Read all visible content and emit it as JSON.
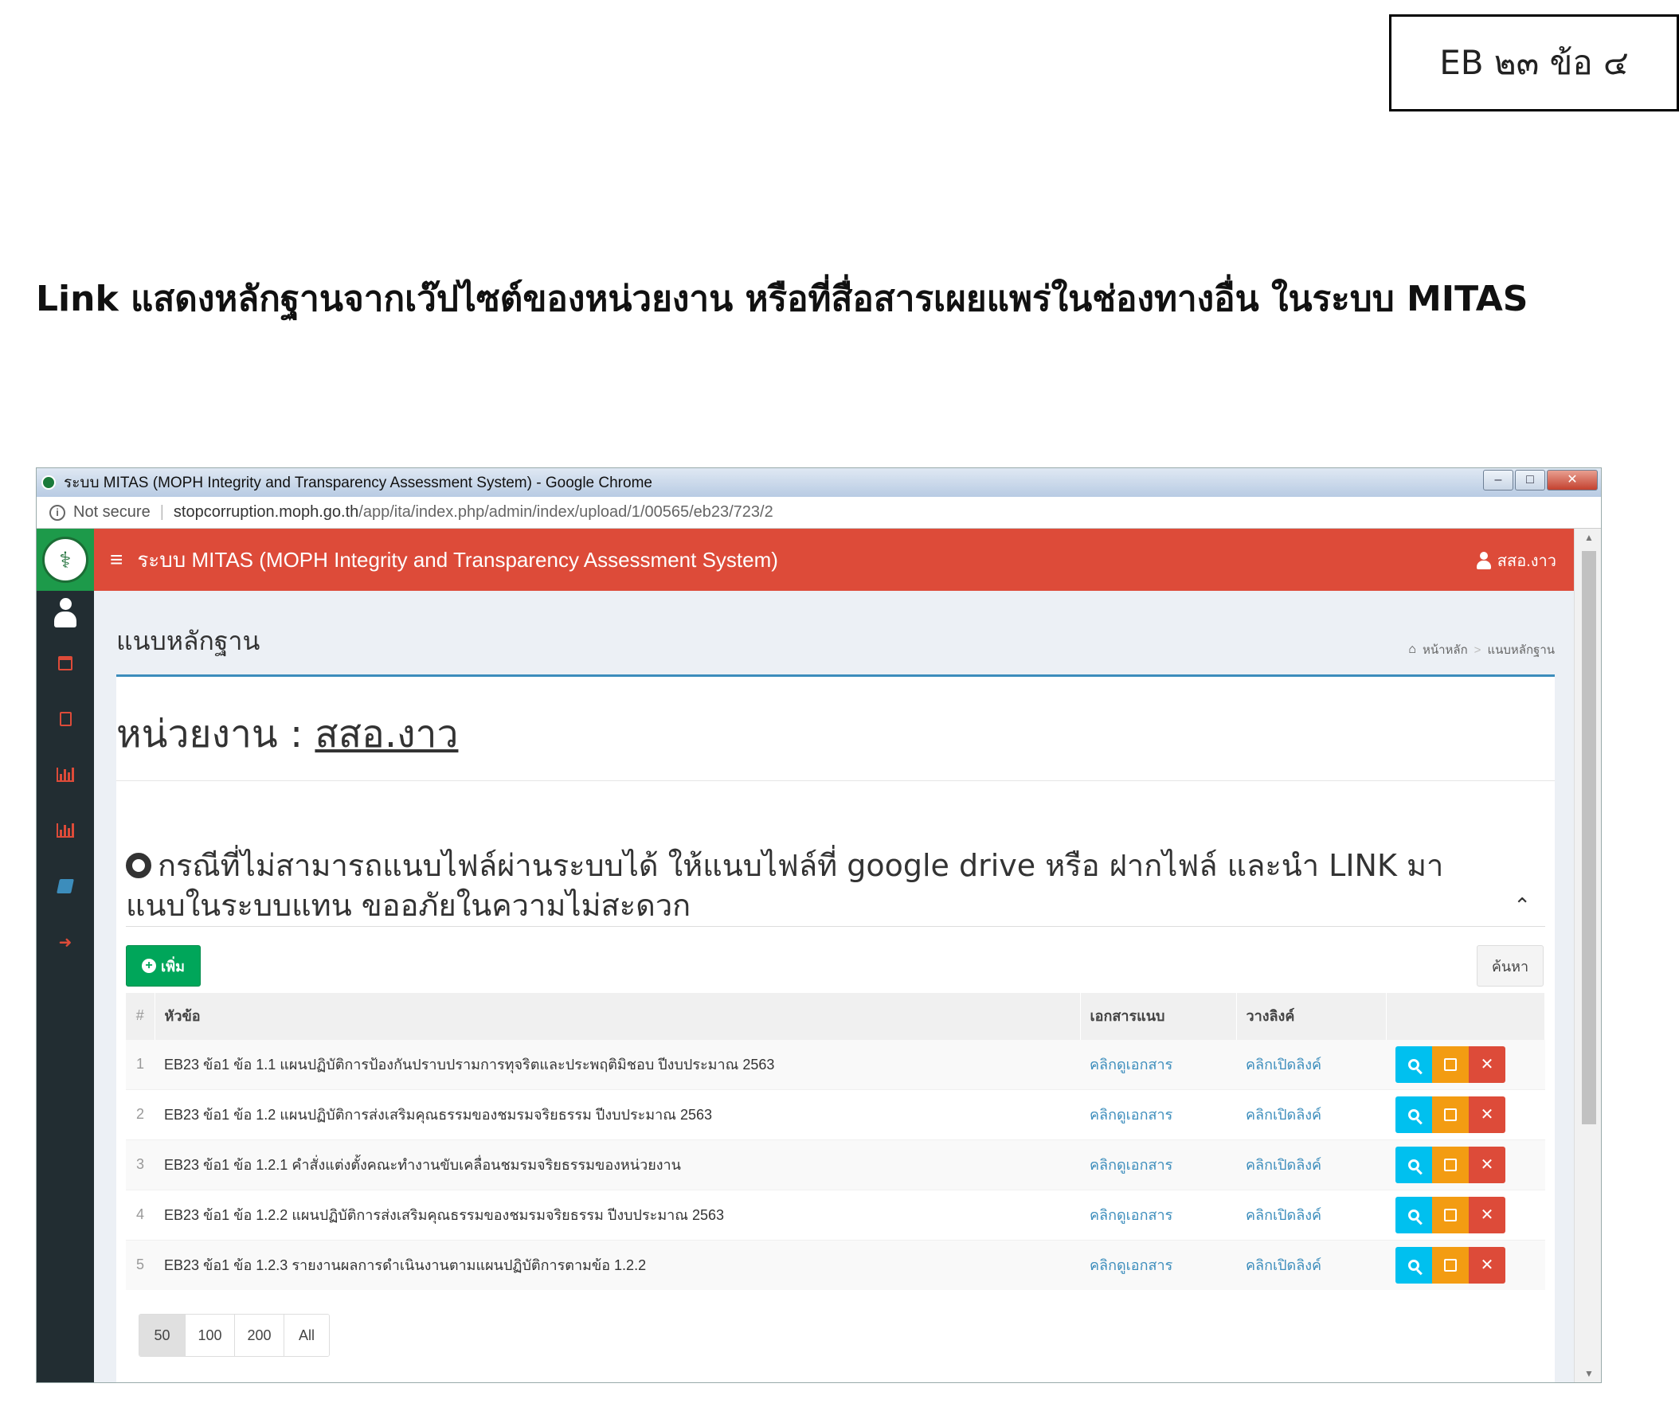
{
  "tag": "EB ๒๓ ข้อ ๔",
  "heading": "Link แสดงหลักฐานจากเว๊ปไซต์ของหน่วยงาน หรือที่สื่อสารเผยแพร่ในช่องทางอื่น ในระบบ MITAS",
  "browser": {
    "window_title": "ระบบ MITAS (MOPH Integrity and Transparency Assessment System) - Google Chrome",
    "security": "Not secure",
    "url_domain": "stopcorruption.moph.go.th",
    "url_path": "/app/ita/index.php/admin/index/upload/1/00565/eb23/723/2"
  },
  "app": {
    "title": "ระบบ MITAS (MOPH Integrity and Transparency Assessment System)",
    "user": "สสอ.งาว",
    "page_title": "แนบหลักฐาน",
    "breadcrumb": {
      "home": "หน้าหลัก",
      "current": "แนบหลักฐาน"
    },
    "unit_label": "หน่วยงาน : ",
    "unit_name": "สสอ.งาว",
    "notice": "กรณีที่ไม่สามารถแนบไฟล์ผ่านระบบได้ ให้แนบไฟล์ที่ google drive หรือ ฝากไฟล์ และนำ LINK มา แนบในระบบแทน ขออภัยในความไม่สะดวก",
    "add_label": "เพิ่ม",
    "search_label": "ค้นหา",
    "columns": {
      "idx": "#",
      "topic": "หัวข้อ",
      "doc": "เอกสารแนบ",
      "link": "วางลิงค์"
    },
    "rows": [
      {
        "idx": "1",
        "topic": "EB23 ข้อ1 ข้อ 1.1 แผนปฏิบัติการป้องกันปราบปรามการทุจริตและประพฤติมิชอบ ปีงบประมาณ 2563",
        "doc": "คลิกดูเอกสาร",
        "link": "คลิกเปิดลิงค์"
      },
      {
        "idx": "2",
        "topic": "EB23 ข้อ1 ข้อ 1.2 แผนปฏิบัติการส่งเสริมคุณธรรมของชมรมจริยธรรม ปีงบประมาณ 2563",
        "doc": "คลิกดูเอกสาร",
        "link": "คลิกเปิดลิงค์"
      },
      {
        "idx": "3",
        "topic": "EB23 ข้อ1 ข้อ 1.2.1 คำสั่งแต่งตั้งคณะทำงานขับเคลื่อนชมรมจริยธรรมของหน่วยงาน",
        "doc": "คลิกดูเอกสาร",
        "link": "คลิกเปิดลิงค์"
      },
      {
        "idx": "4",
        "topic": "EB23 ข้อ1 ข้อ 1.2.2 แผนปฏิบัติการส่งเสริมคุณธรรมของชมรมจริยธรรม ปีงบประมาณ 2563",
        "doc": "คลิกดูเอกสาร",
        "link": "คลิกเปิดลิงค์"
      },
      {
        "idx": "5",
        "topic": "EB23 ข้อ1 ข้อ 1.2.3 รายงานผลการดำเนินงานตามแผนปฏิบัติการตามข้อ 1.2.2",
        "doc": "คลิกดูเอกสาร",
        "link": "คลิกเปิดลิงค์"
      }
    ],
    "page_sizes": [
      "50",
      "100",
      "200",
      "All"
    ]
  },
  "colors": {
    "header": "#dd4b39",
    "sidebar": "#222d32",
    "add": "#00a65a",
    "view": "#00c0ef",
    "edit": "#f39c12",
    "delete": "#dd4b39",
    "link": "#3c8dbc"
  }
}
